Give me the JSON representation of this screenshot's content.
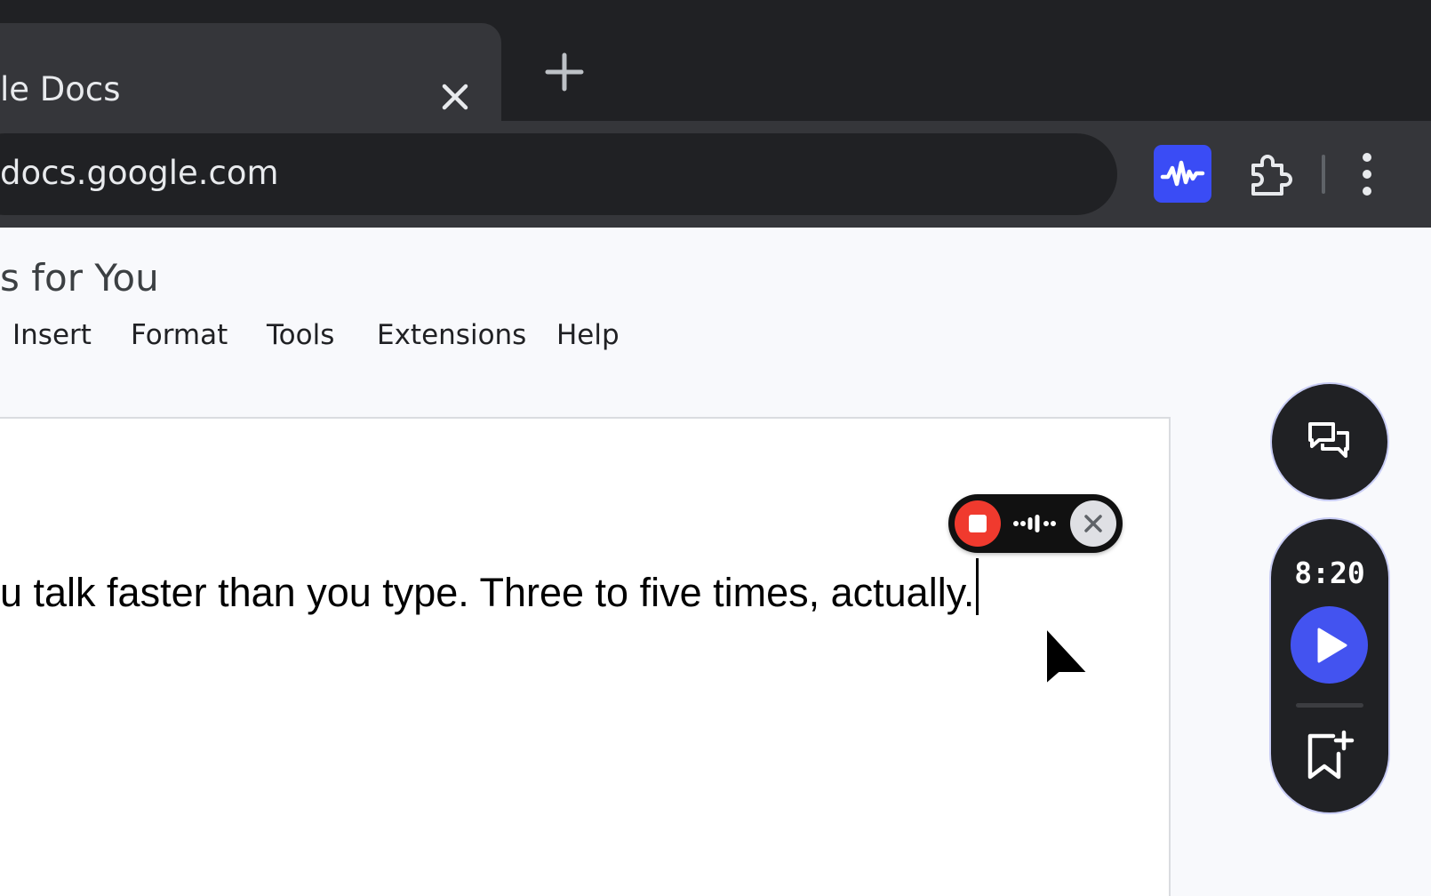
{
  "browser": {
    "tab_title": "le Docs",
    "url": "docs.google.com"
  },
  "docs": {
    "title": "s for You",
    "menu": [
      "Insert",
      "Format",
      "Tools",
      "Extensions",
      "Help"
    ],
    "body_text": "u talk faster than you type. Three to five times, actually."
  },
  "widget": {
    "timer": "8:20"
  },
  "colors": {
    "record_red": "#f03a2e",
    "accent_blue": "#4353f0",
    "extension_blue": "#3a4cf5",
    "chrome_dark": "#202124"
  },
  "icons": {
    "tab_close": "close-icon",
    "new_tab": "plus-icon",
    "extension": "waveform-icon",
    "extensions_menu": "puzzle-icon",
    "browser_menu": "more-vertical-icon",
    "record_stop": "stop-icon",
    "record_cancel": "close-icon",
    "chat": "chat-bubbles-icon",
    "play": "play-icon",
    "bookmark": "bookmark-add-icon"
  }
}
